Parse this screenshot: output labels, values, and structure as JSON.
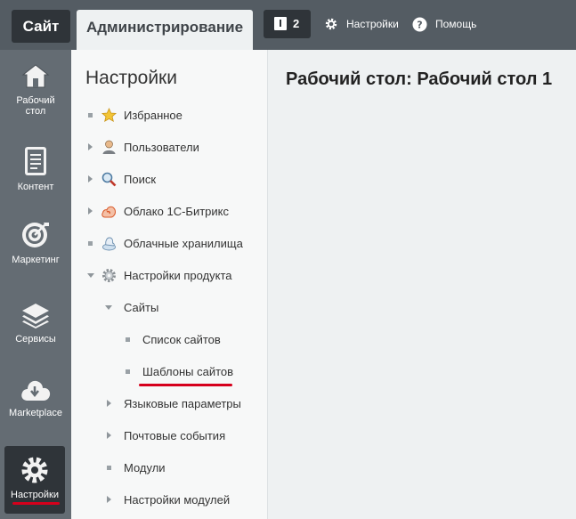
{
  "header": {
    "tab_site": "Сайт",
    "tab_admin": "Администрирование",
    "notifications_count": "2",
    "settings_label": "Настройки",
    "help_label": "Помощь"
  },
  "rail": {
    "items": [
      {
        "label_line1": "Рабочий",
        "label_line2": "стол",
        "icon": "home-icon"
      },
      {
        "label_line1": "Контент",
        "icon": "document-icon"
      },
      {
        "label_line1": "Маркетинг",
        "icon": "target-icon"
      },
      {
        "label_line1": "Сервисы",
        "icon": "layers-icon"
      },
      {
        "label_line1": "Marketplace",
        "icon": "cloud-download-icon"
      },
      {
        "label_line1": "Настройки",
        "icon": "gear-icon"
      }
    ]
  },
  "menu": {
    "title": "Настройки",
    "items": [
      {
        "label": "Избранное",
        "icon": "star-icon"
      },
      {
        "label": "Пользователи",
        "icon": "user-icon"
      },
      {
        "label": "Поиск",
        "icon": "search-icon"
      },
      {
        "label": "Облако 1С-Битрикс",
        "icon": "bitrix-cloud-icon"
      },
      {
        "label": "Облачные хранилища",
        "icon": "cloud-storage-icon"
      },
      {
        "label": "Настройки продукта",
        "icon": "gear-icon"
      },
      {
        "label": "Сайты"
      },
      {
        "label": "Список сайтов"
      },
      {
        "label": "Шаблоны сайтов"
      },
      {
        "label": "Языковые параметры"
      },
      {
        "label": "Почтовые события"
      },
      {
        "label": "Модули"
      },
      {
        "label": "Настройки модулей"
      }
    ]
  },
  "main": {
    "title": "Рабочий стол: Рабочий стол 1"
  },
  "colors": {
    "topbar": "#545c63",
    "rail": "#646c73",
    "dark_tab": "#2f3439",
    "highlight_underline": "#d6001c"
  }
}
